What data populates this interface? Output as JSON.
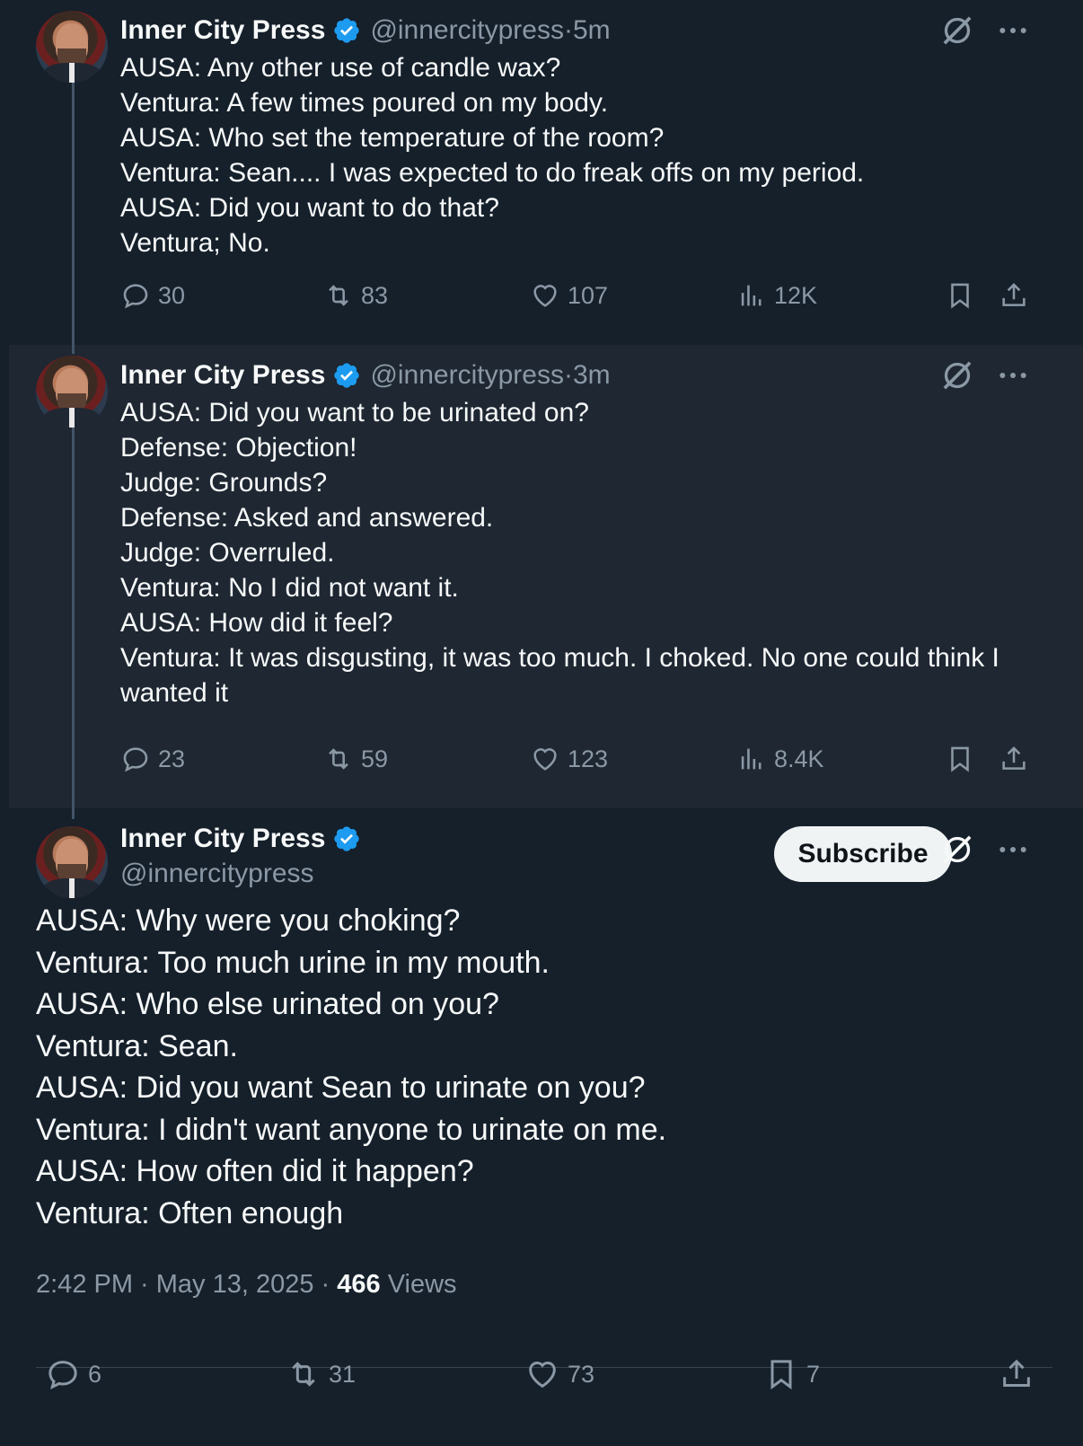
{
  "tweets": [
    {
      "name": "Inner City Press",
      "handle": "@innercitypress",
      "dot": " · ",
      "time": "5m",
      "text": "AUSA: Any other use of candle wax?\nVentura: A few times poured on my body.\nAUSA: Who set the temperature of the room?\nVentura: Sean.... I was expected to do freak offs on my period.\nAUSA: Did you want to do that?\nVentura; No.",
      "replies": "30",
      "reposts": "83",
      "likes": "107",
      "views": "12K"
    },
    {
      "name": "Inner City Press",
      "handle": "@innercitypress",
      "dot": " · ",
      "time": "3m",
      "text": "AUSA: Did you want to be urinated on?\nDefense: Objection!\nJudge: Grounds?\nDefense: Asked and answered.\nJudge: Overruled.\nVentura: No I did not want it.\nAUSA: How did it feel?\nVentura: It was disgusting, it was too much. I choked. No one could think I\nwanted it",
      "replies": "23",
      "reposts": "59",
      "likes": "123",
      "views": "8.4K"
    }
  ],
  "main_tweet": {
    "name": "Inner City Press",
    "handle": "@innercitypress",
    "subscribe_label": "Subscribe",
    "text": "AUSA: Why were you choking?\nVentura: Too much urine in my mouth.\nAUSA: Who else urinated on you?\nVentura: Sean.\nAUSA: Did you want Sean to urinate on you?\nVentura: I didn't want anyone to urinate on me.\nAUSA: How often did it happen?\nVentura: Often enough",
    "timestamp": "2:42 PM · May 13, 2025",
    "sep": " · ",
    "views_count": "466",
    "views_label": " Views",
    "replies": "6",
    "reposts": "31",
    "likes": "73",
    "bookmarks": "7"
  },
  "icons": {
    "verified": "verified-badge-icon",
    "grok": "grok-icon",
    "more": "more-icon",
    "reply": "reply-icon",
    "repost": "repost-icon",
    "like": "like-icon",
    "views": "views-icon",
    "bookmark": "bookmark-icon",
    "share": "share-icon"
  },
  "colors": {
    "background": "#15202b",
    "highlight": "#1e2732",
    "text": "#f7f9f9",
    "muted": "#8b98a5",
    "verified": "#1d9bf0"
  }
}
